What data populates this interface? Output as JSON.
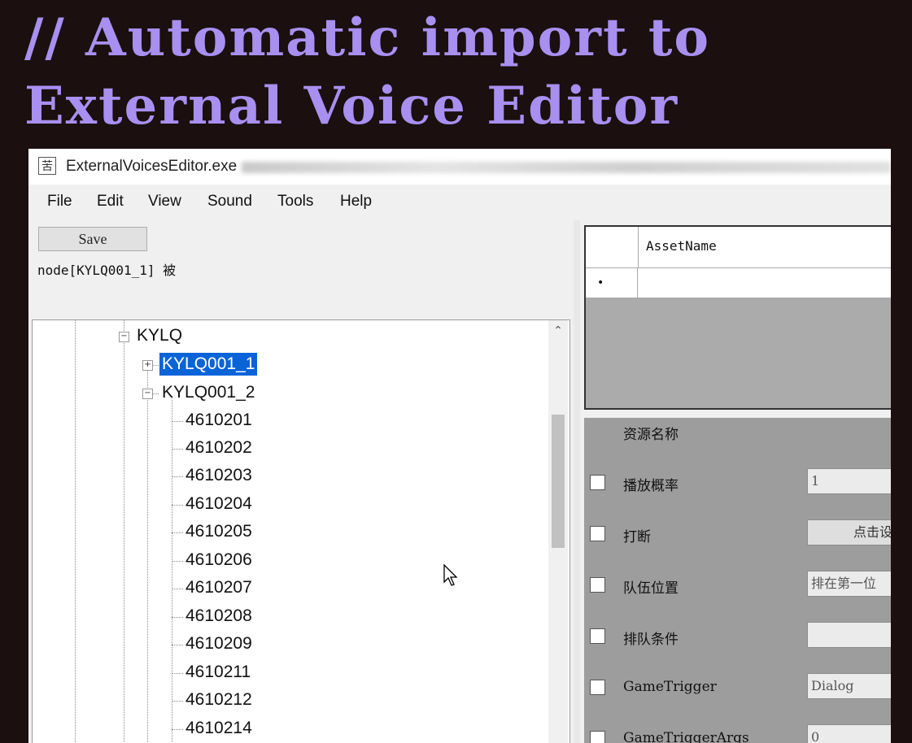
{
  "slide": {
    "title_line1": "// Automatic import to",
    "title_line2": "External Voice Editor"
  },
  "window": {
    "title": "ExternalVoicesEditor.exe",
    "app_icon": "苦"
  },
  "menu": [
    "File",
    "Edit",
    "View",
    "Sound",
    "Tools",
    "Help"
  ],
  "toolbar": {
    "save_label": "Save"
  },
  "status": {
    "text": "node[KYLQ001_1] 被"
  },
  "tree": {
    "root": "KYLQ",
    "nodes": [
      "KYLQ001_1",
      "KYLQ001_2"
    ],
    "selected": "KYLQ001_1",
    "children": [
      "4610201",
      "4610202",
      "4610203",
      "4610204",
      "4610205",
      "4610206",
      "4610207",
      "4610208",
      "4610209",
      "4610211",
      "4610212",
      "4610214"
    ]
  },
  "grid": {
    "column": "AssetName",
    "row_marker": "•"
  },
  "properties": {
    "heading": "资源名称",
    "rows": [
      {
        "label": "播放概率",
        "value": "1"
      },
      {
        "label": "打断",
        "value": "点击设"
      },
      {
        "label": "队伍位置",
        "value": "排在第一位"
      },
      {
        "label": "排队条件",
        "value": ""
      },
      {
        "label": "GameTrigger",
        "value": "Dialog"
      },
      {
        "label": "GameTriggerArgs",
        "value": "0"
      }
    ]
  }
}
